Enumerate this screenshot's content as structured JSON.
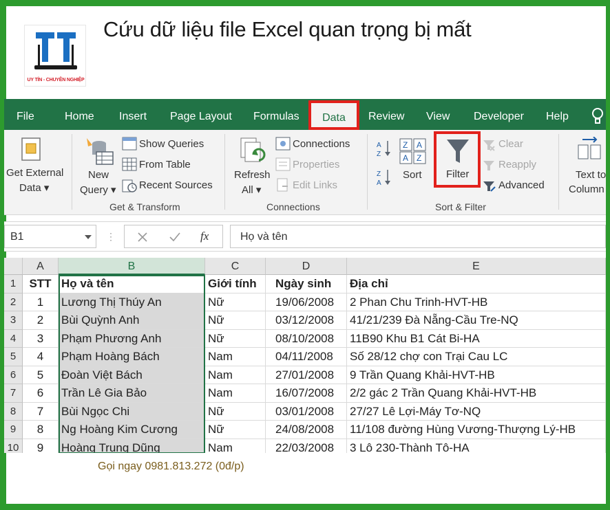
{
  "headline": "Cứu dữ liệu file Excel quan trọng bị mất",
  "logo": {
    "tagline": "UY TÍN - CHUYÊN NGHIỆP"
  },
  "tabs": [
    "File",
    "Home",
    "Insert",
    "Page Layout",
    "Formulas",
    "Data",
    "Review",
    "View",
    "Developer",
    "Help"
  ],
  "active_tab": "Data",
  "ribbon": {
    "get_external": [
      "Get External",
      "Data ▾"
    ],
    "new_query": [
      "New",
      "Query ▾"
    ],
    "show_queries": "Show Queries",
    "from_table": "From Table",
    "recent_sources": "Recent Sources",
    "group_get_transform": "Get & Transform",
    "refresh": [
      "Refresh",
      "All ▾"
    ],
    "connections": "Connections",
    "properties": "Properties",
    "edit_links": "Edit Links",
    "group_connections": "Connections",
    "sort": "Sort",
    "filter": "Filter",
    "clear": "Clear",
    "reapply": "Reapply",
    "advanced": "Advanced",
    "group_sort_filter": "Sort & Filter",
    "text_to_columns": [
      "Text to",
      "Column"
    ]
  },
  "formula_bar": {
    "name_box": "B1",
    "fx": "fx",
    "value": "Họ và tên"
  },
  "columns": [
    "A",
    "B",
    "C",
    "D",
    "E"
  ],
  "header_row": [
    "STT",
    "Họ và tên",
    "Giới tính",
    "Ngày sinh",
    "Địa chỉ"
  ],
  "rows": [
    [
      "1",
      "Lương Thị Thúy An",
      "Nữ",
      "19/06/2008",
      "2 Phan Chu Trinh-HVT-HB"
    ],
    [
      "2",
      "Bùi Quỳnh Anh",
      "Nữ",
      "03/12/2008",
      "41/21/239 Đà Nẵng-Cầu Tre-NQ"
    ],
    [
      "3",
      "Phạm Phương Anh",
      "Nữ",
      "08/10/2008",
      "11B90 Khu B1 Cát Bi-HA"
    ],
    [
      "4",
      "Phạm Hoàng Bách",
      "Nam",
      "04/11/2008",
      "Số 28/12 chợ con Trại Cau LC"
    ],
    [
      "5",
      "Đoàn Việt Bách",
      "Nam",
      "27/01/2008",
      "9 Trần Quang Khải-HVT-HB"
    ],
    [
      "6",
      "Trần Lê Gia Bảo",
      "Nam",
      "16/07/2008",
      "2/2 gác 2 Trần Quang Khải-HVT-HB"
    ],
    [
      "7",
      "Bùi Ngọc Chi",
      "Nữ",
      "03/01/2008",
      "27/27 Lê Lợi-Máy Tơ-NQ"
    ],
    [
      "8",
      "Ng Hoàng Kim Cương",
      "Nữ",
      "24/08/2008",
      "11/108 đường Hùng Vương-Thượng Lý-HB"
    ],
    [
      "9",
      "Hoàng Trung Dũng",
      "Nam",
      "22/03/2008",
      "3 Lô 230-Thành Tô-HA"
    ]
  ],
  "row_numbers": [
    "1",
    "2",
    "3",
    "4",
    "5",
    "6",
    "7",
    "8",
    "9",
    "10"
  ],
  "caption": "Gọi ngay 0981.813.272 (0đ/p)",
  "colors": {
    "excel_green": "#217346",
    "frame_green": "#2d9b2e",
    "highlight_red": "#e2211c"
  }
}
